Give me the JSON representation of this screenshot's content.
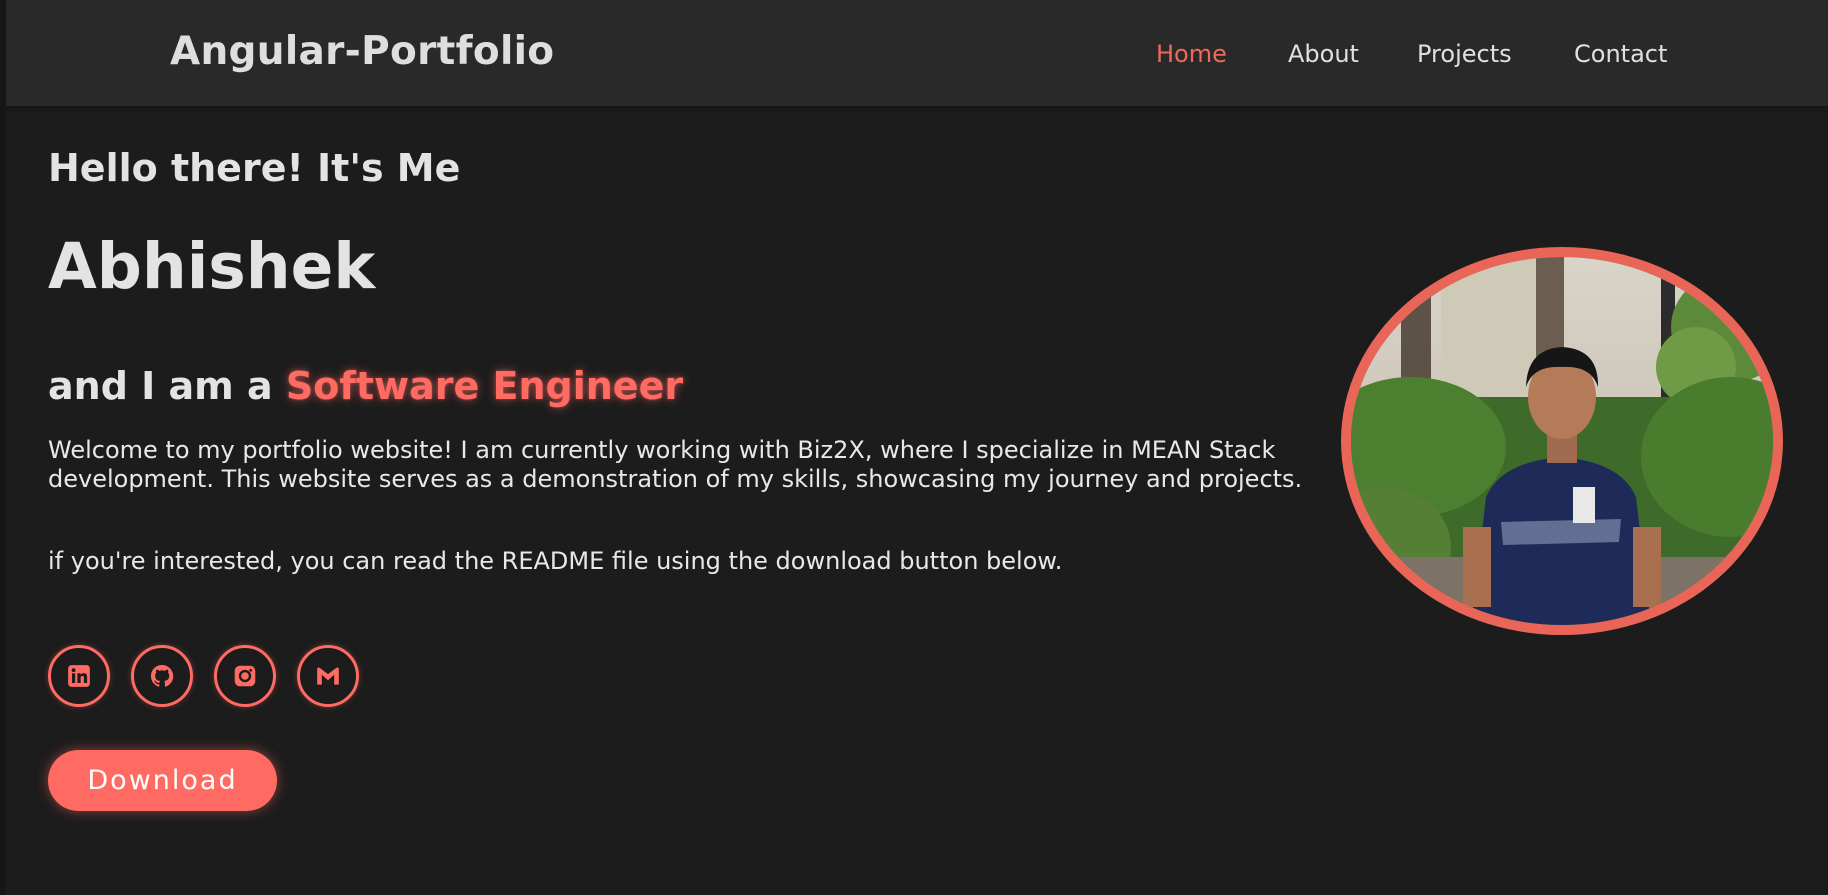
{
  "brand": {
    "title": "Angular-Portfolio"
  },
  "nav": {
    "items": [
      {
        "label": "Home",
        "active": true
      },
      {
        "label": "About",
        "active": false
      },
      {
        "label": "Projects",
        "active": false
      },
      {
        "label": "Contact",
        "active": false
      }
    ]
  },
  "hero": {
    "greeting": "Hello there! It's Me",
    "name": "Abhishek",
    "role_prefix": "and I am a ",
    "role": "Software Engineer",
    "intro": "Welcome to my portfolio website! I am currently working with Biz2X, where I specialize in MEAN Stack development. This website serves as a demonstration of my skills, showcasing my journey and projects.",
    "readme_note": "if you're interested, you can read the README file using the download button below.",
    "download_label": "Download"
  },
  "socials": [
    {
      "icon": "linkedin-icon"
    },
    {
      "icon": "github-icon"
    },
    {
      "icon": "instagram-icon"
    },
    {
      "icon": "gmail-icon"
    }
  ],
  "photo": {
    "subject": "profile-photo"
  },
  "colors": {
    "accent": "#ff6b63",
    "background": "#1c1c1c",
    "navbar": "#2a292a",
    "text": "#e3e3e3"
  }
}
